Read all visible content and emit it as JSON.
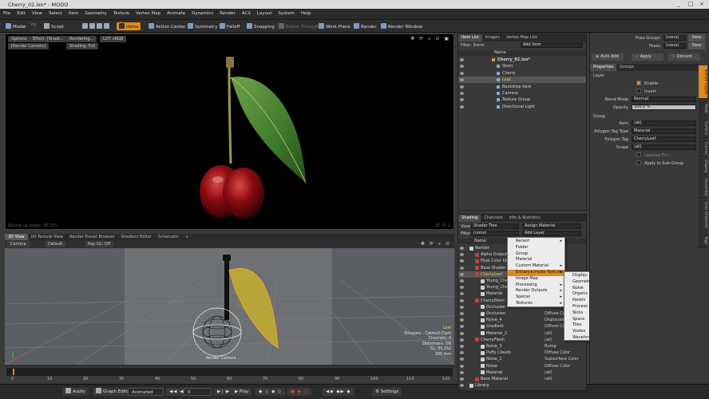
{
  "window": {
    "title": "Cherry_02.lxo* - MODO",
    "controls": [
      "_",
      "□",
      "×"
    ]
  },
  "menubar": [
    "File",
    "Edit",
    "View",
    "Select",
    "Item",
    "Geometry",
    "Texture",
    "Vertex Map",
    "Animate",
    "Dynamics",
    "Render",
    "ACS",
    "Layout",
    "System",
    "Help"
  ],
  "toolbar": {
    "mode": "Model",
    "mode2": "F5",
    "script": "Script",
    "items_label": "Items",
    "action_center": "Action Center",
    "symmetry": "Symmetry",
    "falloff": "Falloff",
    "snapping": "Snapping",
    "select_through": "Select Through",
    "work_plane": "Work Plane",
    "render": "Render",
    "render_window": "Render Window"
  },
  "viewport_top": {
    "options": "Options",
    "effect": "Effect: [Shadi...",
    "rendering": "Rendering...",
    "lut": "LUT: sRGB",
    "camera": "[Render Camera]",
    "shading": "Shading: Full",
    "status": "Baking up stage: 98.33%",
    "coords": "30.00 1"
  },
  "viewport_bottom": {
    "tabs": [
      "3D View",
      "UV Texture View",
      "Render Preset Browser",
      "Gradient Editor",
      "Schematic"
    ],
    "tab_active": "3D View",
    "camera": "Camera",
    "default": "Default",
    "ray_gl": "Ray GL: Off",
    "object_label": "Render Camera",
    "info": [
      "Leaf",
      "Polygons : Catmull-Clark",
      "Channels: 0",
      "Deformers: ON",
      "GL: 65,152",
      "200 mm"
    ]
  },
  "timeline": {
    "ticks": [
      "0",
      "10",
      "20",
      "30",
      "40",
      "50",
      "60",
      "70",
      "80",
      "90",
      "100",
      "110",
      "120"
    ]
  },
  "bottombar": {
    "audio": "Audio",
    "graph_editor": "Graph Editor",
    "animated": "Animated",
    "frame": "0",
    "play": "Play",
    "settings": "Settings"
  },
  "item_list": {
    "tabs": [
      "Item List",
      "Images",
      "Vertex Map List"
    ],
    "filter_label": "Filter: Items",
    "add_item": "Add Item",
    "col_name": "Name",
    "rows": [
      {
        "name": "Cherry_02.lxo*",
        "indent": 0,
        "bold": true
      },
      {
        "name": "Stem",
        "indent": 1
      },
      {
        "name": "Cherry",
        "indent": 1
      },
      {
        "name": "Leaf",
        "indent": 1,
        "selected": true
      },
      {
        "name": "Backdrop Item",
        "indent": 1
      },
      {
        "name": "Camera",
        "indent": 1
      },
      {
        "name": "Texture Group",
        "indent": 1
      },
      {
        "name": "Directional Light",
        "indent": 1
      }
    ]
  },
  "shading": {
    "tabs": [
      "Shading",
      "Channels",
      "Info & Statistics"
    ],
    "view_label": "View",
    "view_value": "Shader Tree",
    "assign_material": "Assign Material",
    "filter_label": "Filter",
    "filter_value": "(none)",
    "add_layer": "Add Layer",
    "col_name": "Name",
    "rows": [
      {
        "name": "Render",
        "effect": "",
        "indent": 0
      },
      {
        "name": "Alpha Output",
        "effect": "",
        "indent": 1
      },
      {
        "name": "Final Color Output",
        "effect": "",
        "indent": 1
      },
      {
        "name": "Base Shader",
        "effect": "",
        "indent": 1
      },
      {
        "name": "CherryLeaf",
        "effect": "",
        "indent": 1,
        "selected": true
      },
      {
        "name": "Young_Cherry",
        "effect": "",
        "indent": 2
      },
      {
        "name": "Young_Cherry",
        "effect": "",
        "indent": 2
      },
      {
        "name": "Material",
        "effect": "",
        "indent": 2
      },
      {
        "name": "CherryStem",
        "effect": "",
        "indent": 1
      },
      {
        "name": "Occlusion",
        "effect": "",
        "indent": 2
      },
      {
        "name": "Occlusion",
        "effect": "Diffuse Color",
        "indent": 2
      },
      {
        "name": "Noise_4",
        "effect": "Displacement",
        "indent": 2
      },
      {
        "name": "Gradient",
        "effect": "Diffuse Color",
        "indent": 2
      },
      {
        "name": "Material_2",
        "effect": "(all)",
        "indent": 2
      },
      {
        "name": "CherryFlesh",
        "effect": "(all)",
        "indent": 1
      },
      {
        "name": "Noise_3",
        "effect": "Bump",
        "indent": 2
      },
      {
        "name": "Puffy Clouds",
        "effect": "Diffuse Color",
        "indent": 2
      },
      {
        "name": "Noise_2",
        "effect": "Subsurface Color",
        "indent": 2
      },
      {
        "name": "Noise",
        "effect": "Diffuse Color",
        "indent": 2
      },
      {
        "name": "Material",
        "effect": "(all)",
        "indent": 2
      },
      {
        "name": "Base Material",
        "effect": "(all)",
        "indent": 1
      },
      {
        "name": "Library",
        "effect": "",
        "indent": 0
      }
    ]
  },
  "context_menu": {
    "items": [
      {
        "label": "Recent",
        "sub": true
      },
      {
        "label": "Folder"
      },
      {
        "label": "Group"
      },
      {
        "label": "Material"
      },
      {
        "label": "Custom Material",
        "sub": true
      },
      {
        "label": "Enhance:modo Textures",
        "sub": true,
        "highlighted": true
      },
      {
        "label": "Image Map"
      },
      {
        "label": "Processing",
        "sub": true
      },
      {
        "label": "Render Outputs",
        "sub": true
      },
      {
        "label": "Special",
        "sub": true
      },
      {
        "label": "Textures",
        "sub": true
      }
    ],
    "submenu": [
      {
        "label": "Display",
        "sub": true
      },
      {
        "label": "Geometric",
        "sub": true
      },
      {
        "label": "Noise",
        "sub": true
      },
      {
        "label": "Organic",
        "sub": true
      },
      {
        "label": "Panels",
        "sub": true
      },
      {
        "label": "Process",
        "sub": true
      },
      {
        "label": "Skins",
        "sub": true
      },
      {
        "label": "Space",
        "sub": true
      },
      {
        "label": "Tiles",
        "sub": true
      },
      {
        "label": "Voxlex",
        "sub": true
      },
      {
        "label": "Waveforms",
        "sub": true
      }
    ]
  },
  "pose": {
    "groups_label": "Pose Groups",
    "groups_value": "(none)",
    "poses_label": "Poses",
    "poses_value": "(none)",
    "new": "New"
  },
  "actions": {
    "auto_add": "Auto Add",
    "apply": "Apply",
    "discard": "Discard"
  },
  "properties": {
    "tabs": [
      "Properties",
      "Groups"
    ],
    "section_layer": "Layer",
    "enable": "Enable",
    "invert": "Invert",
    "blend_mode_label": "Blend Mode",
    "blend_mode": "Normal",
    "opacity_label": "Opacity",
    "opacity": "100.0 %",
    "section_group": "Group",
    "item_label": "Item",
    "item": "(all)",
    "ptag_type_label": "Polygon Tag Type",
    "ptag_type": "Material",
    "ptag_label": "Polygon Tag",
    "ptag": "CherryLeaf",
    "scope_label": "Scope",
    "scope": "(all)",
    "layered_fur": "Layered Fur",
    "apply_subgroup": "Apply to Sub-Group",
    "side_tabs": [
      "Texture Layers",
      "Mesh",
      "Surface",
      "Curves",
      "Display",
      "Assembly",
      "User Channels",
      "Tags"
    ]
  }
}
